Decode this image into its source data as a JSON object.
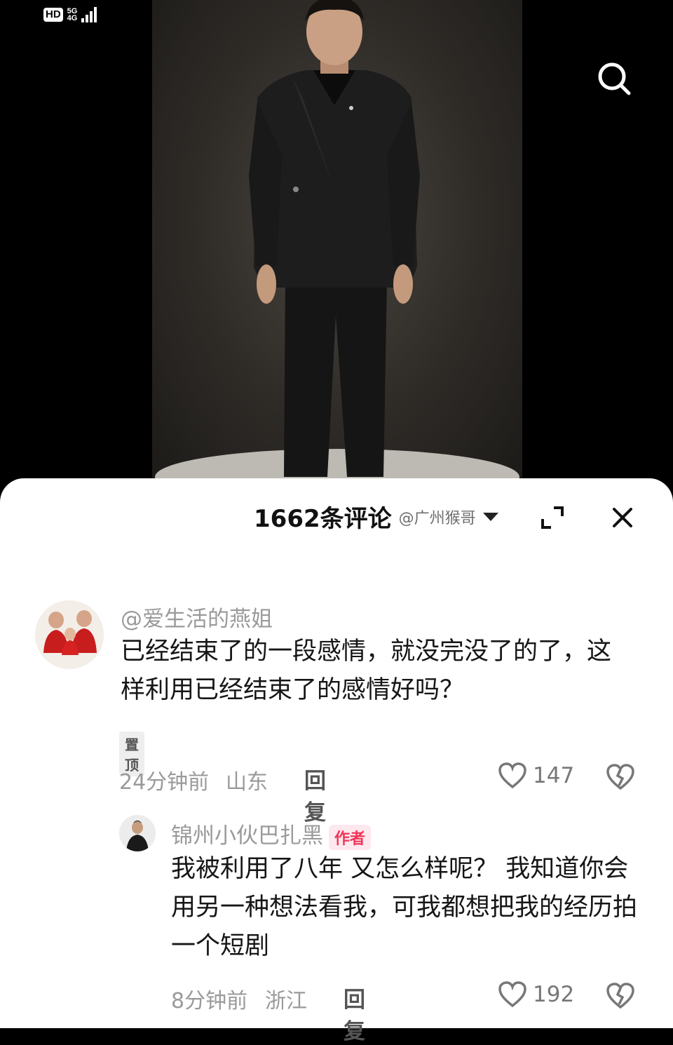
{
  "status": {
    "hd": "HD",
    "network_top": "5G",
    "network_bottom": "4G"
  },
  "video": {
    "search_icon": "search-icon"
  },
  "comments_panel": {
    "title": "1662条评论",
    "watermark": "@广州猴哥",
    "expand_icon": "expand-icon",
    "close_icon": "close-icon"
  },
  "comments": [
    {
      "username": "@爱生活的燕姐",
      "text": "已经结束了的一段感情，就没完没了的了，这样利用已经结束了的感情好吗？",
      "pinned_label": "置顶",
      "time": "24分钟前",
      "location": "山东",
      "reply_label": "回复",
      "likes": "147"
    },
    {
      "username": "锦州小伙巴扎黑",
      "author_label": "作者",
      "text": "我被利用了八年 又怎么样呢？ 我知道你会用另一种想法看我，可我都想把我的经历拍一个短剧",
      "time": "8分钟前",
      "location": "浙江",
      "reply_label": "回复",
      "likes": "192"
    }
  ],
  "colors": {
    "author_badge": "#f0365a",
    "sheet_bg": "#ffffff",
    "muted_text": "#9a9a9a"
  }
}
